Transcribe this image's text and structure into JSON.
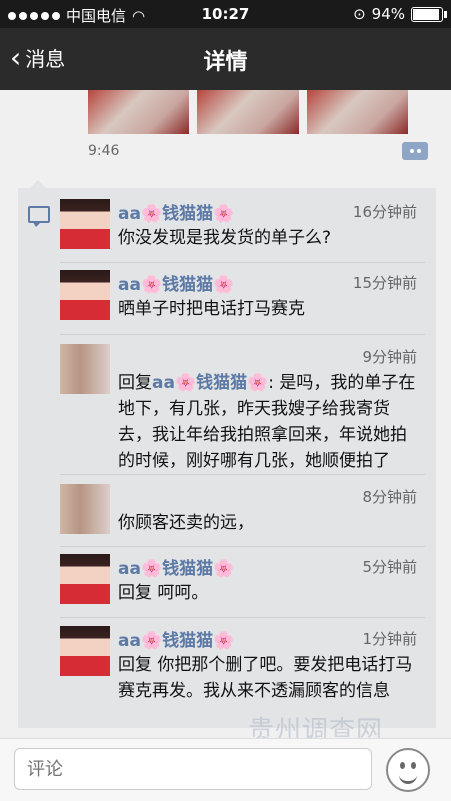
{
  "status": {
    "carrier": "中国电信",
    "time": "10:27",
    "battery": "94%"
  },
  "nav": {
    "back_label": "消息",
    "title": "详情"
  },
  "post": {
    "time": "9:46"
  },
  "comments": [
    {
      "name": "aa🌸钱猫猫🌸",
      "time": "16分钟前",
      "text": "你没发现是我发货的单子么?"
    },
    {
      "name": "aa🌸钱猫猫🌸",
      "time": "15分钟前",
      "text": "晒单子时把电话打马赛克"
    },
    {
      "name": "",
      "time": "9分钟前",
      "reply_prefix": "回复",
      "reply_to": "aa🌸钱猫猫🌸",
      "text": ": 是吗，我的单子在地下，有几张，昨天我嫂子给我寄货去，我让年给我拍照拿回来，年说她拍的时候，刚好哪有几张，她顺便拍了"
    },
    {
      "name": "",
      "time": "8分钟前",
      "text": "你顾客还卖的远，"
    },
    {
      "name": "aa🌸钱猫猫🌸",
      "time": "5分钟前",
      "text": "回复      呵呵。"
    },
    {
      "name": "aa🌸钱猫猫🌸",
      "time": "1分钟前",
      "text": "回复      你把那个删了吧。要发把电话打马赛克再发。我从来不透漏顾客的信息"
    }
  ],
  "footer": {
    "placeholder": "评论"
  },
  "watermark": "贵州调查网"
}
